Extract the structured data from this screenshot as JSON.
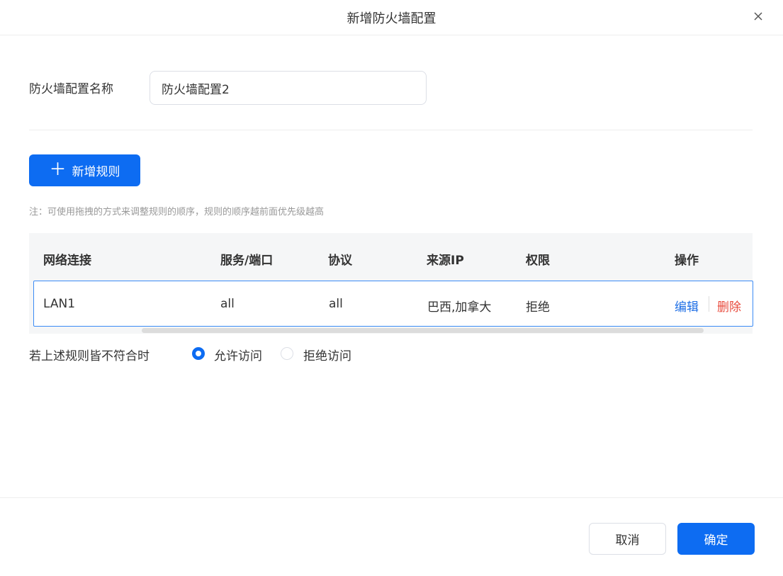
{
  "dialog": {
    "title": "新增防火墙配置"
  },
  "form": {
    "name_label": "防火墙配置名称",
    "name_value": "防火墙配置2"
  },
  "toolbar": {
    "add_rule_label": "新增规则",
    "plus_glyph": "＋"
  },
  "note": "注：可使用拖拽的方式来调整规则的顺序，规则的顺序越前面优先级越高",
  "table": {
    "columns": [
      "网络连接",
      "服务/端口",
      "协议",
      "来源IP",
      "权限",
      "操作"
    ],
    "rows": [
      {
        "network": "LAN1",
        "service": "all",
        "protocol": "all",
        "source_ip": "巴西,加拿大",
        "permission": "拒绝",
        "edit": "编辑",
        "delete": "删除"
      }
    ]
  },
  "fallback": {
    "label": "若上述规则皆不符合时",
    "options": [
      {
        "label": "允许访问",
        "checked": true
      },
      {
        "label": "拒绝访问",
        "checked": false
      }
    ]
  },
  "footer": {
    "cancel_label": "取消",
    "confirm_label": "确定"
  },
  "colors": {
    "primary": "#0d6cf2",
    "danger": "#e84a3c",
    "link": "#1f6fe5"
  }
}
